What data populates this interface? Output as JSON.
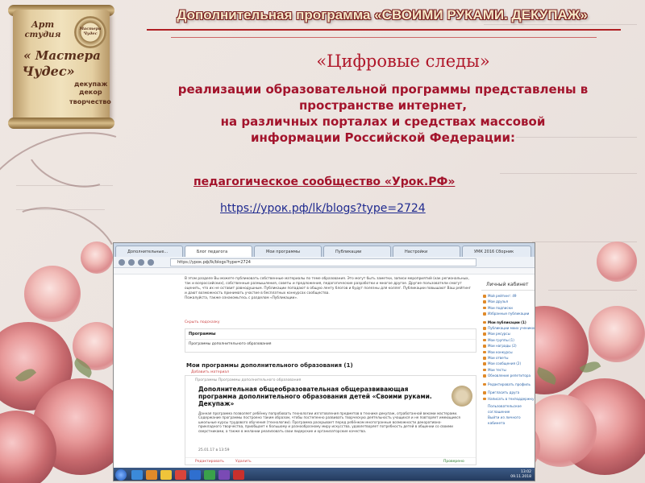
{
  "logo": {
    "line1": "Арт",
    "line2": "студия",
    "line3": "« Мастера",
    "line4": "Чудес»",
    "seal": "Мастера Чудес",
    "tags": [
      "декупаж",
      "декор",
      "творчество"
    ]
  },
  "header": {
    "title": "Дополнительная программа «СВОИМИ РУКАМИ. ДЕКУПАЖ»"
  },
  "main": {
    "title": "«Цифровые следы»",
    "body_lines": [
      "реализации образовательной программы представлены в",
      "пространстве интернет,",
      "на различных порталах и средствах массовой",
      "информации Российской Федерации:"
    ],
    "community": "педагогическое сообщество «Урок.РФ»",
    "link": "https://урок.рф/lk/blogs?type=2724"
  },
  "screenshot": {
    "tabs": [
      "Дополнительные...",
      "Блог педагога",
      "Мои программы",
      "Публикации",
      "Настройки",
      "УМК 2016 Сборник"
    ],
    "url": "https://урок.рф/lk/blogs?type=2724",
    "info_text": "В этом разделе Вы можете публиковать собственные материалы по теме образования. Это могут быть заметки, записи мероприятий (как региональных, так и всероссийских), собственные размышления, советы и предложения, педагогические разработки и многое другое. Другие пользователи смогут оценить, что их не оставит равнодушным. Публикации попадают в общую ленту блогов и будут полезны для коллег. Публикации повышают Ваш рейтинг и дают возможность принимать участие в бесплатных конкурсах сообщества.",
    "info_extra": "Пожалуйста, также ознакомьтесь с разделом «Публикации».",
    "info_link": "Скрыть подсказку",
    "programs_box": {
      "heading": "Программы",
      "row": "Программы дополнительного образования"
    },
    "programs_title": "Мои программы дополнительного образования (1)",
    "add_program": "Добавить материал",
    "program": {
      "category": "Программы   Программы дополнительного образования",
      "heading": "Дополнительная общеобразовательная общеразвивающая программа дополнительного образования детей «Своими руками. Декупаж»",
      "description": "Данная программа позволяет ребёнку попробовать технологии изготовления предметов в технике декупаж, отработанной веками мастерами. Содержание программы построено таким образом, чтобы постепенно развивать творческую деятельность учащихся и не повторяет имеющиеся школьные курсы трудового обучения (технологии). Программа раскрывает перед ребёнком многогранные возможности декоративно-прикладного творчества, приобщает к большому и разнообразному миру искусства, удовлетворяет потребность детей в общении со своими сверстниками, а также в желании реализовать свои лидерские и организаторские качества.",
      "date": "25.01.17 в 13:59",
      "edit": "Редактировать",
      "delete": "Удалить",
      "status": "Проверено"
    },
    "cabinet": {
      "title": "Личный кабинет",
      "items": [
        "Мой рейтинг: 49",
        "Мои друзья",
        "Мои подписки",
        "Избранные публикации",
        "Мои публикации (1)",
        "Публикации моих учеников",
        "Мои ресурсы",
        "Мои группы (1)",
        "Мои награды (2)",
        "Мои конкурсы",
        "Мои ответы",
        "Мои сообщения (2)",
        "Мои тесты",
        "Обновление репетитора",
        "Редактировать профиль",
        "Пригласить друга",
        "Написать в техподдержку"
      ],
      "footer": [
        "Пользовательское соглашение",
        "Выйти из личного кабинета"
      ]
    },
    "clock": {
      "time": "13:02",
      "date": "09.11.2018"
    }
  }
}
